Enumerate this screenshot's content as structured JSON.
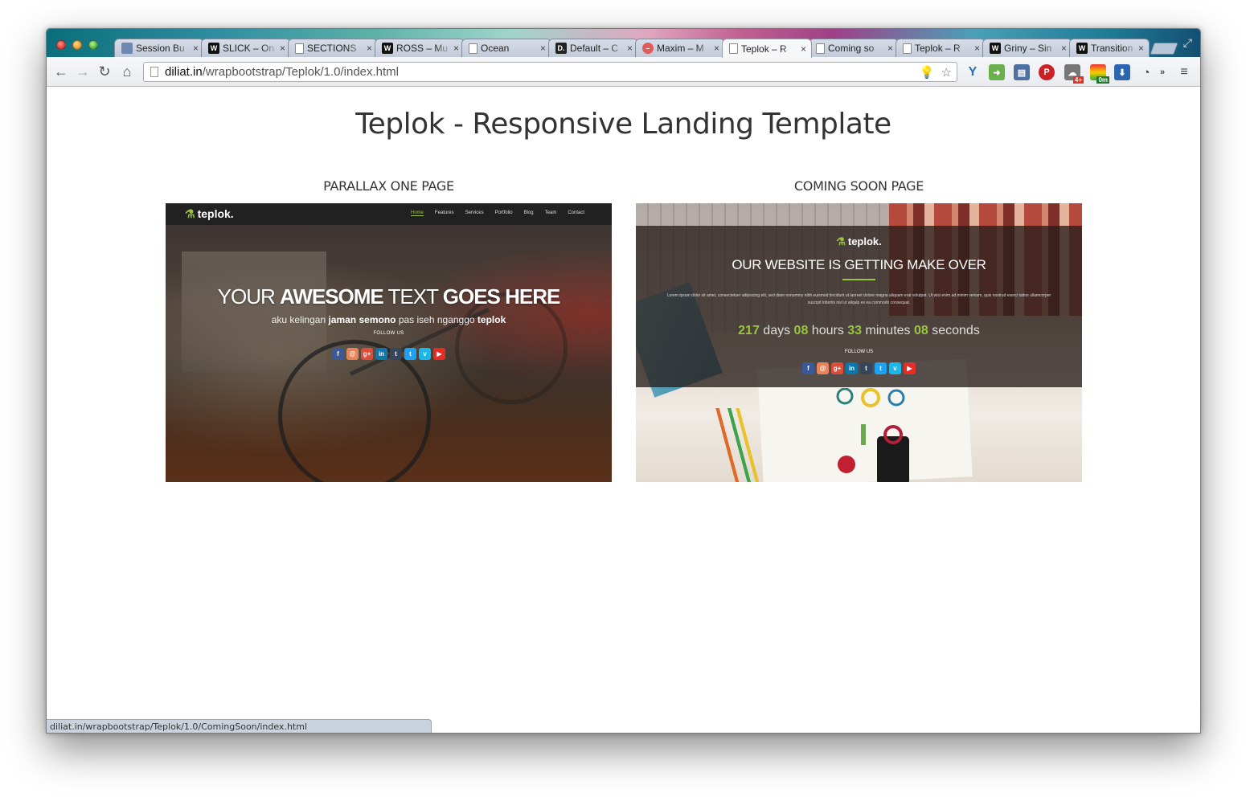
{
  "browser": {
    "tabs": [
      {
        "label": "Session Bu",
        "icon": "session-buddy-icon"
      },
      {
        "label": "SLICK – On",
        "icon": "wrapbootstrap-w-icon"
      },
      {
        "label": "SECTIONS",
        "icon": "page-icon"
      },
      {
        "label": "ROSS – Mu",
        "icon": "wrapbootstrap-w-icon"
      },
      {
        "label": "Ocean",
        "icon": "page-icon"
      },
      {
        "label": "Default – C",
        "icon": "d-icon"
      },
      {
        "label": "Maxim – M",
        "icon": "circle-icon"
      },
      {
        "label": "Teplok – R",
        "icon": "page-icon",
        "active": true
      },
      {
        "label": "Coming so",
        "icon": "page-icon"
      },
      {
        "label": "Teplok – R",
        "icon": "page-icon"
      },
      {
        "label": "Griny – Sin",
        "icon": "wrapbootstrap-w-icon"
      },
      {
        "label": "Transition",
        "icon": "wrapbootstrap-w-icon"
      }
    ],
    "close_glyph": "×",
    "url_host": "diliat.in",
    "url_path": "/wrapbootstrap/Teplok/1.0/index.html",
    "extensions": {
      "badge_1": "4+",
      "badge_2": "0m"
    },
    "status_url": "diliat.in/wrapbootstrap/Teplok/1.0/ComingSoon/index.html"
  },
  "page": {
    "title": "Teplok - Responsive Landing Template",
    "cards": [
      {
        "title": "PARALLAX ONE PAGE",
        "logo": "teplok.",
        "nav": [
          "Home",
          "Features",
          "Services",
          "Portfolio",
          "Blog",
          "Team",
          "Contact"
        ],
        "headline_1": "YOUR ",
        "headline_2": "AWESOME",
        "headline_3": " TEXT ",
        "headline_4": "GOES HERE",
        "sub_1": "aku kelingan ",
        "sub_2": "jaman semono",
        "sub_3": " pas iseh nganggo ",
        "sub_4": "teplok",
        "follow": "FOLLOW US"
      },
      {
        "title": "COMING SOON PAGE",
        "logo": "teplok.",
        "heading": "OUR WEBSITE IS GETTING MAKE OVER",
        "lorem": "Lorem ipsum dolor sit amet, consectetuer adipiscing elit, sed diam nonummy nibh euismod tincidunt ut laoreet dolore magna aliquam erat volutpat. Ut wisi enim ad minim veniam, quis nostrud exerci tation ullamcorper suscipit lobortis nisl ut aliquip ex ea commodo consequat.",
        "countdown": {
          "days": "217",
          "days_label": " days ",
          "hours": "08",
          "hours_label": " hours ",
          "minutes": "33",
          "minutes_label": " minutes ",
          "seconds": "08",
          "seconds_label": " seconds"
        },
        "follow": "FOLLOW US"
      }
    ],
    "social_icons": [
      {
        "glyph": "f",
        "icon": "facebook-icon",
        "color": "#3b5998"
      },
      {
        "glyph": "@",
        "icon": "email-icon",
        "color": "#e8845a"
      },
      {
        "glyph": "g+",
        "icon": "google-plus-icon",
        "color": "#dd4b39"
      },
      {
        "glyph": "in",
        "icon": "linkedin-icon",
        "color": "#0e76a8"
      },
      {
        "glyph": "t",
        "icon": "tumblr-icon",
        "color": "#35465c"
      },
      {
        "glyph": "t",
        "icon": "twitter-icon",
        "color": "#1da1f2"
      },
      {
        "glyph": "v",
        "icon": "vimeo-icon",
        "color": "#1ab7ea"
      },
      {
        "glyph": "▶",
        "icon": "youtube-icon",
        "color": "#e52d27"
      }
    ],
    "accent_color": "#9bc53d"
  }
}
